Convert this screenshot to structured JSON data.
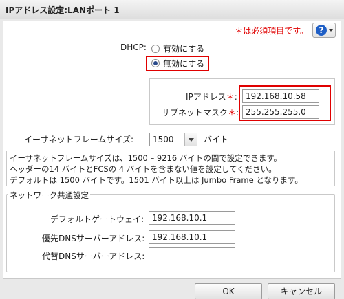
{
  "window": {
    "title": "IPアドレス設定:LANポート 1"
  },
  "required_note": "＊は必須項目です。",
  "help": {
    "icon": "help-icon",
    "label": "?"
  },
  "dhcp": {
    "label": "DHCP:",
    "options": [
      {
        "label": "有効にする",
        "selected": false
      },
      {
        "label": "無効にする",
        "selected": true
      }
    ]
  },
  "ip": {
    "label": "IPアドレス",
    "star": "＊",
    "colon": ":",
    "value": "192.168.10.58"
  },
  "subnet": {
    "label": "サブネットマスク",
    "star": "＊",
    "colon": ":",
    "value": "255.255.255.0"
  },
  "frame": {
    "label": "イーサネットフレームサイズ:",
    "value": "1500",
    "unit": "バイト"
  },
  "note_lines": [
    "イーサネットフレームサイズは、1500 – 9216 バイトの間で設定できます。",
    "ヘッダーの14 バイトとFCSの 4 バイトを含まない値を設定してください。",
    "デフォルトは 1500 バイトです。1501 バイト以上は Jumbo Frame となります。"
  ],
  "network": {
    "legend": "ネットワーク共通設定",
    "gateway": {
      "label": "デフォルトゲートウェイ:",
      "value": "192.168.10.1"
    },
    "dns1": {
      "label": "優先DNSサーバーアドレス:",
      "value": "192.168.10.1"
    },
    "dns2": {
      "label": "代替DNSサーバーアドレス:",
      "value": ""
    }
  },
  "buttons": {
    "ok": "OK",
    "cancel": "キャンセル"
  },
  "colors": {
    "required": "#e00000",
    "highlight": "#e00000",
    "help": "#1f5fc6"
  }
}
